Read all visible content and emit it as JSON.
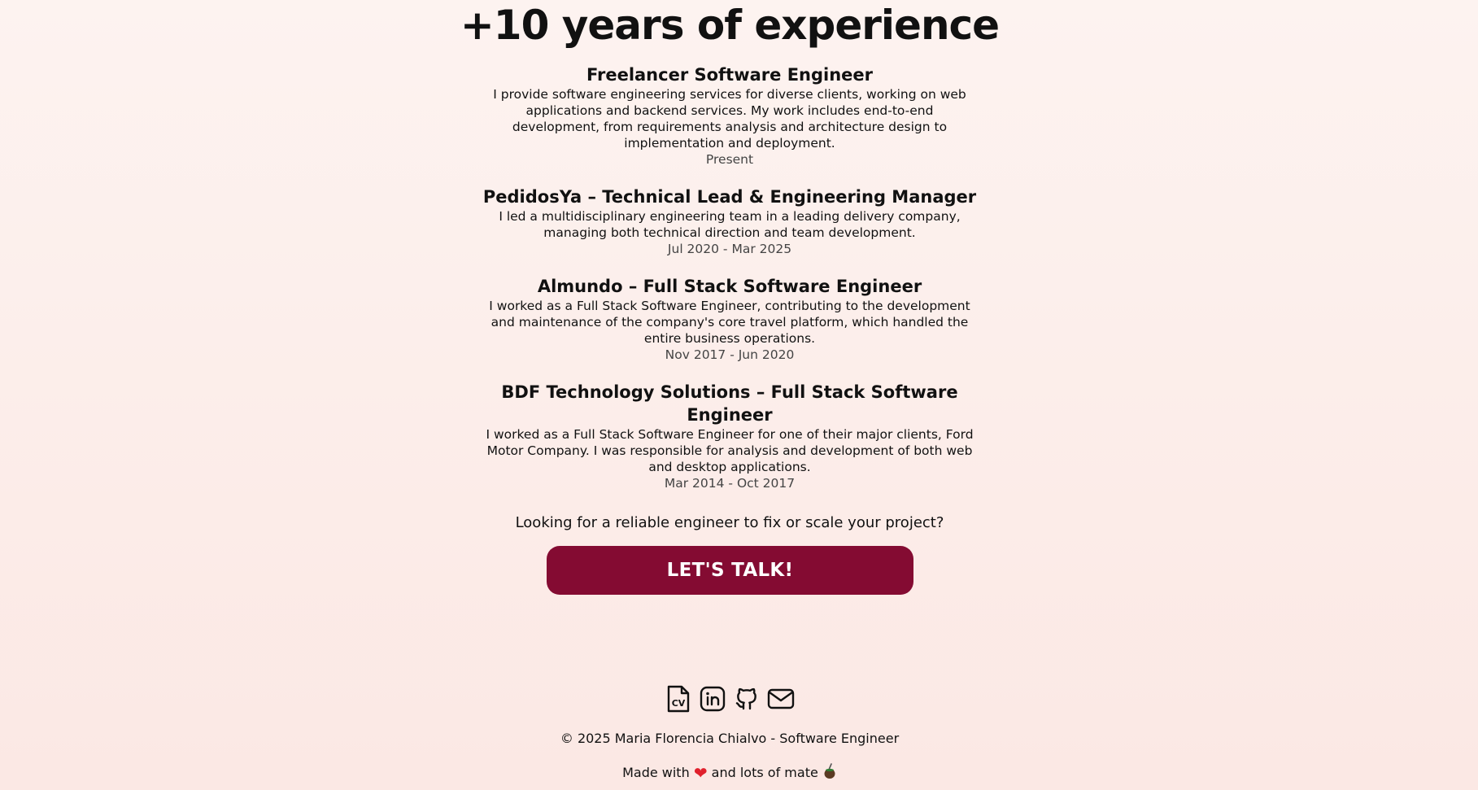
{
  "experience": {
    "title": "+10 years of experience",
    "jobs": [
      {
        "title": "Freelancer Software Engineer",
        "description": "I provide software engineering services for diverse clients, working on web applications and backend services. My work includes end-to-end development, from requirements analysis and architecture design to implementation and deployment.",
        "dates": "Present"
      },
      {
        "title": "PedidosYa – Technical Lead & Engineering Manager",
        "description": "I led a multidisciplinary engineering team in a leading delivery company, managing both technical direction and team development.",
        "dates": "Jul 2020 - Mar 2025"
      },
      {
        "title": "Almundo – Full Stack Software Engineer",
        "description": "I worked as a Full Stack Software Engineer, contributing to the development and maintenance of the company's core travel platform, which handled the entire business operations.",
        "dates": "Nov 2017 - Jun 2020"
      },
      {
        "title": "BDF Technology Solutions – Full Stack Software Engineer",
        "description": "I worked as a Full Stack Software Engineer for one of their major clients, Ford Motor Company. I was responsible for analysis and development of both web and desktop applications.",
        "dates": "Mar 2014 - Oct 2017"
      }
    ]
  },
  "cta": {
    "text": "Looking for a reliable engineer to fix or scale your project?",
    "button_label": "LET'S TALK!"
  },
  "footer": {
    "social_icons": [
      "cv-icon",
      "linkedin-icon",
      "github-icon",
      "mail-icon"
    ],
    "copyright": "© 2025 Maria Florencia Chialvo - Software Engineer",
    "made_with_prefix": "Made with",
    "made_with_suffix": "and lots of mate"
  },
  "colors": {
    "button_bg": "#840b32",
    "background": "#fdf3f0",
    "heart": "#e0202c"
  }
}
